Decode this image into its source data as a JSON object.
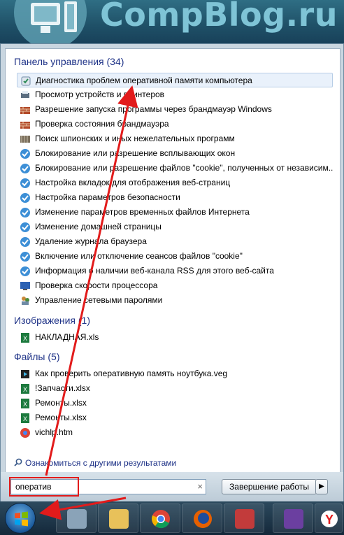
{
  "banner": {
    "title": "CompBlog.ru"
  },
  "sections": {
    "control_panel": {
      "header": "Панель управления (34)",
      "items": [
        {
          "label": "Диагностика проблем оперативной памяти компьютера",
          "icon": "memory-diagnostic-icon",
          "selected": true
        },
        {
          "label": "Просмотр устройств и принтеров",
          "icon": "printer-icon"
        },
        {
          "label": "Разрешение запуска программы через брандмауэр Windows",
          "icon": "firewall-icon"
        },
        {
          "label": "Проверка состояния брандмауэра",
          "icon": "firewall-icon"
        },
        {
          "label": "Поиск шпионских и иных нежелательных программ",
          "icon": "defender-icon"
        },
        {
          "label": "Блокирование или разрешение всплывающих окон",
          "icon": "internet-options-icon"
        },
        {
          "label": "Блокирование или разрешение файлов \"cookie\", полученных от независим...",
          "icon": "internet-options-icon"
        },
        {
          "label": "Настройка вкладок для отображения веб-страниц",
          "icon": "internet-options-icon"
        },
        {
          "label": "Настройка параметров безопасности",
          "icon": "internet-options-icon"
        },
        {
          "label": "Изменение параметров временных файлов Интернета",
          "icon": "internet-options-icon"
        },
        {
          "label": "Изменение домашней страницы",
          "icon": "internet-options-icon"
        },
        {
          "label": "Удаление журнала браузера",
          "icon": "internet-options-icon"
        },
        {
          "label": "Включение или отключение сеансов файлов \"cookie\"",
          "icon": "internet-options-icon"
        },
        {
          "label": "Информация о наличии веб-канала RSS для этого веб-сайта",
          "icon": "internet-options-icon"
        },
        {
          "label": "Проверка скорости процессора",
          "icon": "system-icon"
        },
        {
          "label": "Управление сетевыми паролями",
          "icon": "users-icon"
        }
      ]
    },
    "images": {
      "header": "Изображения (1)",
      "items": [
        {
          "label": "НАКЛАДНАЯ.xls",
          "icon": "excel-icon"
        }
      ]
    },
    "files": {
      "header": "Файлы (5)",
      "items": [
        {
          "label": "Как проверить оперативную память ноутбука.veg",
          "icon": "video-file-icon"
        },
        {
          "label": "!Запчасти.xlsx",
          "icon": "excel-icon"
        },
        {
          "label": "Ремонты.xlsx",
          "icon": "excel-icon"
        },
        {
          "label": "Ремонты.xlsx",
          "icon": "excel-icon"
        },
        {
          "label": "vichlp.htm",
          "icon": "chrome-file-icon"
        }
      ]
    }
  },
  "see_more": "Ознакомиться с другими результатами",
  "search": {
    "value": "оператив",
    "clear_glyph": "×"
  },
  "shutdown": {
    "label": "Завершение работы",
    "arrow": "▶"
  },
  "taskbar": {
    "apps": [
      "calculator-icon",
      "explorer-icon",
      "chrome-icon",
      "firefox-icon",
      "app-icon",
      "save-icon",
      "yandex-browser-icon"
    ],
    "watermark": "CompBlog"
  },
  "colors": {
    "accent_header": "#1e3287",
    "annotation_red": "#e21b1b"
  }
}
